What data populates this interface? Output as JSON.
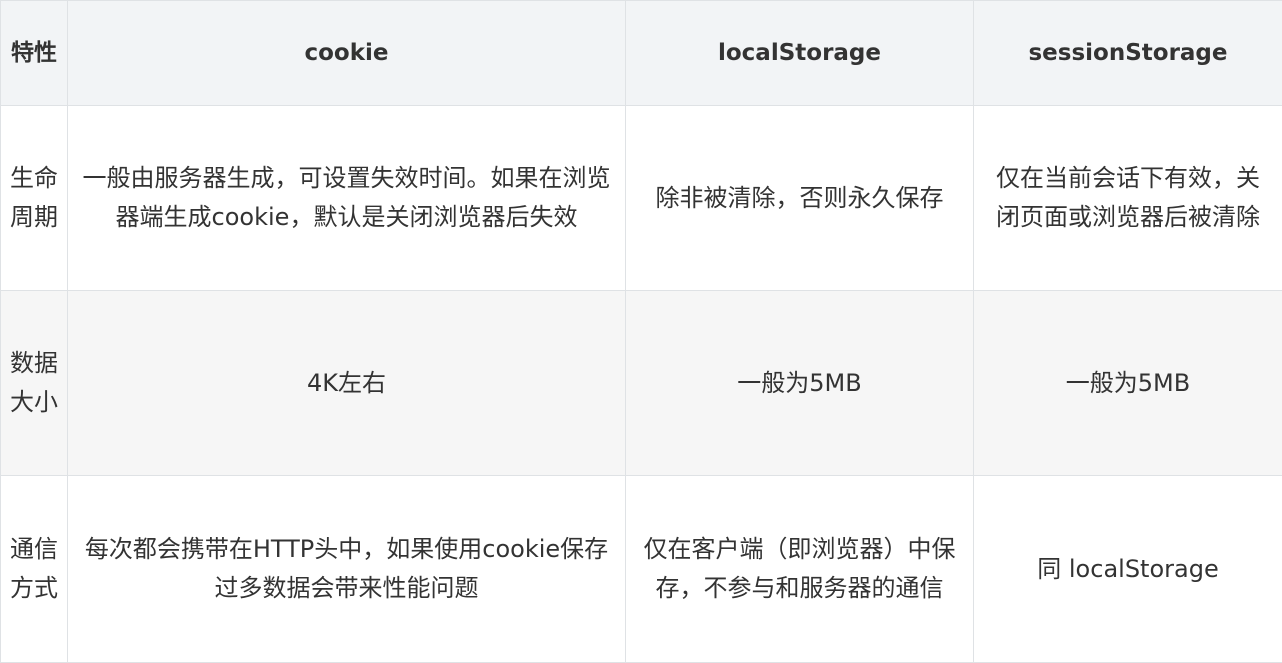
{
  "table": {
    "headers": [
      "特性",
      "cookie",
      "localStorage",
      "sessionStorage"
    ],
    "rows": [
      {
        "feature": "生命周期",
        "cookie": "一般由服务器生成，可设置失效时间。如果在浏览器端生成cookie，默认是关闭浏览器后失效",
        "localStorage": "除非被清除，否则永久保存",
        "sessionStorage": "仅在当前会话下有效，关闭页面或浏览器后被清除"
      },
      {
        "feature": "数据大小",
        "cookie": "4K左右",
        "localStorage": "一般为5MB",
        "sessionStorage": "一般为5MB"
      },
      {
        "feature": "通信方式",
        "cookie": "每次都会携带在HTTP头中，如果使用cookie保存过多数据会带来性能问题",
        "localStorage": "仅在客户端（即浏览器）中保存，不参与和服务器的通信",
        "sessionStorage": "同 localStorage"
      }
    ]
  }
}
